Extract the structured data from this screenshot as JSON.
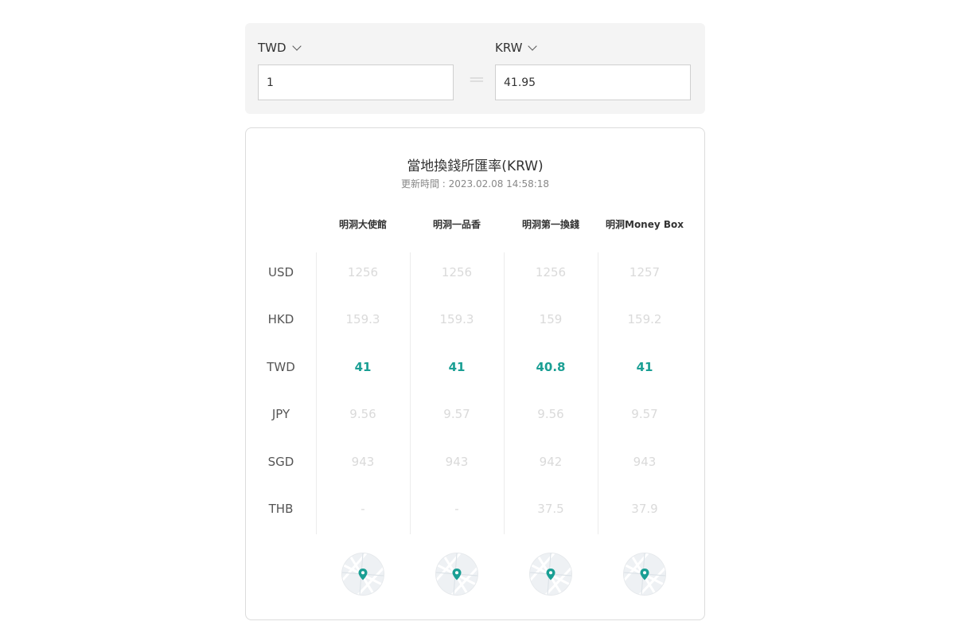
{
  "converter": {
    "from_currency": "TWD",
    "to_currency": "KRW",
    "from_amount": "1",
    "to_amount": "41.95",
    "equals_sign": "="
  },
  "rates": {
    "title": "當地換錢所匯率(KRW)",
    "updated": "更新時間 : 2023.02.08 14:58:18",
    "exchangers": [
      "明洞大使館",
      "明洞一品香",
      "明洞第一換錢",
      "明洞Money Box"
    ],
    "rows": [
      {
        "currency": "USD",
        "values": [
          "1256",
          "1256",
          "1256",
          "1257"
        ],
        "highlight": false
      },
      {
        "currency": "HKD",
        "values": [
          "159.3",
          "159.3",
          "159",
          "159.2"
        ],
        "highlight": false
      },
      {
        "currency": "TWD",
        "values": [
          "41",
          "41",
          "40.8",
          "41"
        ],
        "highlight": true
      },
      {
        "currency": "JPY",
        "values": [
          "9.56",
          "9.57",
          "9.56",
          "9.57"
        ],
        "highlight": false
      },
      {
        "currency": "SGD",
        "values": [
          "943",
          "943",
          "942",
          "943"
        ],
        "highlight": false
      },
      {
        "currency": "THB",
        "values": [
          "-",
          "-",
          "37.5",
          "37.9"
        ],
        "highlight": false
      }
    ],
    "map_icon": "map-pin-icon",
    "accent_color": "#1a9f94",
    "muted_color": "#dadada"
  }
}
